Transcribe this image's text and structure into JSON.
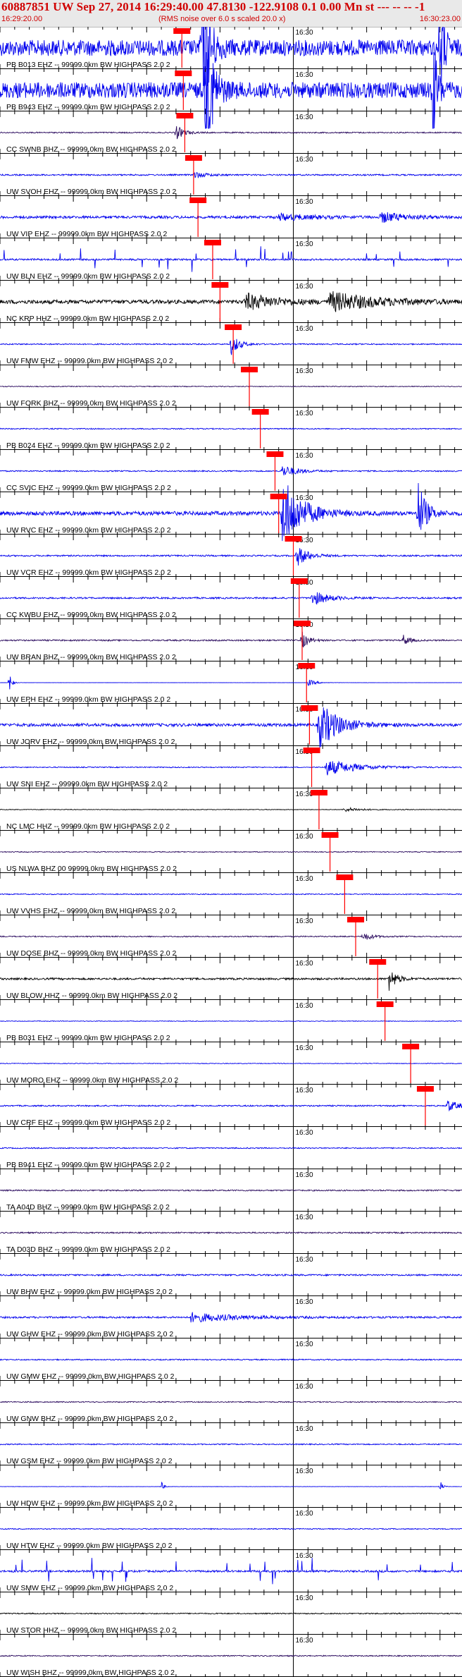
{
  "header": {
    "title": "60887851 UW Sep 27, 2014 16:29:40.00   47.8130 -122.9108  0.1 0.00 Mn st --- -- --   -1",
    "start_time": "16:29:20.00",
    "scale_note": "(RMS noise over 6.0 s scaled 20.0 x)",
    "end_time": "16:30:23.00"
  },
  "colors": {
    "header_text": "#d00000",
    "pick_box": "#ff0000",
    "trace_blue": "#0000ee",
    "trace_black": "#000000",
    "trace_purple": "#2a0a5e"
  },
  "chart_data": {
    "type": "line",
    "x_start": "16:29:20.00",
    "x_end": "16:30:23.00",
    "minute_label": "16:30",
    "tick_interval_s": 2,
    "channels": [
      {
        "label": "PB B013 EHZ -- 99999.0km BW  HIGHPASS  2.0  2",
        "color": "#0000ee",
        "amp": 3.0,
        "bursts": [
          [
            27.5,
            2.0,
            0.9
          ],
          [
            60.0,
            1.5,
            0.5
          ]
        ],
        "pick_s": 24.8,
        "noise": 1.0
      },
      {
        "label": "PB B943 EHZ -- 99999.0km BW  HIGHPASS  2.0  2",
        "color": "#0000ee",
        "amp": 3.0,
        "bursts": [
          [
            28.0,
            2.0,
            0.9
          ],
          [
            59.0,
            1.5,
            0.5
          ]
        ],
        "pick_s": 25.0,
        "noise": 1.0
      },
      {
        "label": "CC SWNB BHZ -- 99999.0km BW  HIGHPASS  2.0  2",
        "color": "#2a0a5e",
        "amp": 0.5,
        "bursts": [
          [
            24.0,
            1.0,
            1.0
          ]
        ],
        "pick_s": 25.2,
        "noise": 0.45
      },
      {
        "label": "UW SVOH EHZ -- 99999.0km BW  HIGHPASS  2.0  2",
        "color": "#0000ee",
        "amp": 0.45,
        "bursts": [
          [
            26.5,
            0.5,
            1.5
          ]
        ],
        "pick_s": 26.4,
        "noise": 0.6
      },
      {
        "label": "UW VIP EHZ -- 99999.0km BW  HIGHPASS  2.0  2",
        "color": "#0000ee",
        "amp": 0.6,
        "bursts": [
          [
            38.0,
            0.4,
            4.0
          ],
          [
            52.0,
            0.6,
            3.0
          ]
        ],
        "pick_s": 27.0,
        "noise": 0.8
      },
      {
        "label": "UW BLN EHZ -- 99999.0km BW  HIGHPASS  2.0  2",
        "color": "#0000ee",
        "amp": 0.9,
        "bursts": [],
        "pick_s": 29.0,
        "noise": 0.35,
        "spiky": true
      },
      {
        "label": "NC KRP HHZ -- 99999.0km BW  HIGHPASS  2.0  2",
        "color": "#000000",
        "amp": 0.9,
        "bursts": [
          [
            33.5,
            0.6,
            4.0
          ],
          [
            45.0,
            0.7,
            6.0
          ]
        ],
        "pick_s": 30.0,
        "noise": 0.8
      },
      {
        "label": "UW FMW EHZ -- 99999.0km BW  HIGHPASS  2.0  2",
        "color": "#0000ee",
        "amp": 0.5,
        "bursts": [
          [
            31.5,
            1.5,
            1.0
          ]
        ],
        "pick_s": 31.8,
        "noise": 0.45
      },
      {
        "label": "UW FORK BHZ -- 99999.0km BW  HIGHPASS  2.0  2",
        "color": "#2a0a5e",
        "amp": 0.3,
        "bursts": [],
        "pick_s": 34.0,
        "noise": 0.5
      },
      {
        "label": "PB B024 EHZ -- 99999.0km BW  HIGHPASS  2.0  2",
        "color": "#0000ee",
        "amp": 0.35,
        "bursts": [],
        "pick_s": 35.5,
        "noise": 0.55
      },
      {
        "label": "CC SVIC EHZ -- 99999.0km BW  HIGHPASS  2.0  2",
        "color": "#0000ee",
        "amp": 0.45,
        "bursts": [
          [
            38.5,
            0.9,
            2.0
          ]
        ],
        "pick_s": 37.5,
        "noise": 0.5
      },
      {
        "label": "UW RVC EHZ -- 99999.0km BW  HIGHPASS  2.0  2",
        "color": "#0000ee",
        "amp": 2.5,
        "bursts": [
          [
            38.5,
            1.0,
            2.5
          ],
          [
            57.0,
            0.9,
            1.0
          ]
        ],
        "pick_s": 38.0,
        "noise": 0.3
      },
      {
        "label": "UW VCR EHZ -- 99999.0km BW  HIGHPASS  2.0  2",
        "color": "#0000ee",
        "amp": 0.7,
        "bursts": [
          [
            40.5,
            1.0,
            1.5
          ]
        ],
        "pick_s": 40.0,
        "noise": 0.4
      },
      {
        "label": "CC KWBU EHZ -- 99999.0km BW  HIGHPASS  2.0  2",
        "color": "#0000ee",
        "amp": 0.6,
        "bursts": [
          [
            42.5,
            0.9,
            2.0
          ]
        ],
        "pick_s": 40.8,
        "noise": 0.5
      },
      {
        "label": "UW BRAN BHZ -- 99999.0km BW  HIGHPASS  2.0  2",
        "color": "#2a0a5e",
        "amp": 0.6,
        "bursts": [
          [
            41.2,
            1.0,
            0.8
          ],
          [
            55.0,
            0.6,
            0.8
          ]
        ],
        "pick_s": 41.2,
        "noise": 0.45
      },
      {
        "label": "UW EPH EHZ -- 99999.0km BW  HIGHPASS  2.0  2",
        "color": "#0000ee",
        "amp": 0.8,
        "bursts": [
          [
            1.3,
            0.9,
            0.3
          ],
          [
            42.0,
            0.3,
            1.0
          ]
        ],
        "pick_s": 41.8,
        "noise": 0.05
      },
      {
        "label": "UW JORV EHZ -- 99999.0km BW  HIGHPASS  2.0  2",
        "color": "#0000ee",
        "amp": 1.6,
        "bursts": [
          [
            43.5,
            1.0,
            2.5
          ]
        ],
        "pick_s": 42.2,
        "noise": 0.35
      },
      {
        "label": "UW SNI EHZ -- 99999.0km BW  HIGHPASS  2.0  2",
        "color": "#0000ee",
        "amp": 0.6,
        "bursts": [
          [
            44.5,
            0.9,
            4.0
          ]
        ],
        "pick_s": 42.5,
        "noise": 0.3
      },
      {
        "label": "NC LMC HHZ -- 99999.0km BW  HIGHPASS  2.0  2",
        "color": "#000000",
        "amp": 0.25,
        "bursts": [
          [
            47.0,
            0.6,
            2.0
          ]
        ],
        "pick_s": 43.5,
        "noise": 0.5
      },
      {
        "label": "US NLWA BHZ 00 99999.0km BW  HIGHPASS  2.0  2",
        "color": "#2a0a5e",
        "amp": 0.3,
        "bursts": [],
        "pick_s": 45.0,
        "noise": 0.55
      },
      {
        "label": "UW VVHS EHZ -- 99999.0km BW  HIGHPASS  2.0  2",
        "color": "#0000ee",
        "amp": 0.3,
        "bursts": [],
        "pick_s": 47.0,
        "noise": 0.6
      },
      {
        "label": "UW DOSE BHZ -- 99999.0km BW  HIGHPASS  2.0  2",
        "color": "#2a0a5e",
        "amp": 0.35,
        "bursts": [
          [
            49.5,
            0.8,
            1.2
          ]
        ],
        "pick_s": 48.5,
        "noise": 0.6
      },
      {
        "label": "UW BLOW HHZ -- 99999.0km BW  HIGHPASS  2.0  2",
        "color": "#000000",
        "amp": 0.8,
        "bursts": [
          [
            53.0,
            1.0,
            1.0
          ]
        ],
        "pick_s": 51.5,
        "noise": 0.45
      },
      {
        "label": "PB B031 EHZ -- 99999.0km BW  HIGHPASS  2.0  2",
        "color": "#0000ee",
        "amp": 0.25,
        "bursts": [],
        "pick_s": 52.5,
        "noise": 0.5
      },
      {
        "label": "UW MORO EHZ -- 99999.0km BW  HIGHPASS  2.0  2",
        "color": "#0000ee",
        "amp": 0.25,
        "bursts": [],
        "pick_s": 56.0,
        "noise": 0.5
      },
      {
        "label": "UW CRF EHZ -- 99999.0km BW  HIGHPASS  2.0  2",
        "color": "#0000ee",
        "amp": 0.45,
        "bursts": [
          [
            61.0,
            0.9,
            1.5
          ]
        ],
        "pick_s": 58.0,
        "noise": 0.55
      },
      {
        "label": "PB B941 EHZ -- 99999.0km BW  HIGHPASS  2.0  2",
        "color": "#0000ee",
        "amp": 0.3,
        "bursts": [],
        "pick_s": null,
        "noise": 0.7
      },
      {
        "label": "TA A04D BHZ -- 99999.0km BW  HIGHPASS  2.0  2",
        "color": "#2a0a5e",
        "amp": 0.35,
        "bursts": [],
        "pick_s": null,
        "noise": 0.7
      },
      {
        "label": "TA D03D BHZ -- 99999.0km BW  HIGHPASS  2.0  2",
        "color": "#2a0a5e",
        "amp": 0.35,
        "bursts": [],
        "pick_s": null,
        "noise": 0.7
      },
      {
        "label": "UW BHW EHZ -- 99999.0km BW  HIGHPASS  2.0  2",
        "color": "#0000ee",
        "amp": 0.4,
        "bursts": [],
        "pick_s": null,
        "noise": 0.75
      },
      {
        "label": "UW GHW EHZ -- 99999.0km BW  HIGHPASS  2.0  2",
        "color": "#0000ee",
        "amp": 0.45,
        "bursts": [
          [
            26.0,
            0.7,
            6.0
          ]
        ],
        "pick_s": null,
        "noise": 0.75
      },
      {
        "label": "UW GMW EHZ -- 99999.0km BW  HIGHPASS  2.0  2",
        "color": "#0000ee",
        "amp": 0.3,
        "bursts": [],
        "pick_s": null,
        "noise": 0.7
      },
      {
        "label": "UW GNW BHZ -- 99999.0km BW  HIGHPASS  2.0  2",
        "color": "#2a0a5e",
        "amp": 0.3,
        "bursts": [],
        "pick_s": null,
        "noise": 0.65
      },
      {
        "label": "UW GSM EHZ -- 99999.0km BW  HIGHPASS  2.0  2",
        "color": "#0000ee",
        "amp": 0.3,
        "bursts": [],
        "pick_s": null,
        "noise": 0.7
      },
      {
        "label": "UW HDW EHZ -- 99999.0km BW  HIGHPASS  2.0  2",
        "color": "#0000ee",
        "amp": 0.6,
        "bursts": [
          [
            22.0,
            0.6,
            0.3
          ],
          [
            60.0,
            0.8,
            0.3
          ]
        ],
        "pick_s": null,
        "noise": 0.1
      },
      {
        "label": "UW HTW EHZ -- 99999.0km BW  HIGHPASS  2.0  2",
        "color": "#0000ee",
        "amp": 0.3,
        "bursts": [],
        "pick_s": null,
        "noise": 0.6
      },
      {
        "label": "UW SMW EHZ -- 99999.0km BW  HIGHPASS  2.0  2",
        "color": "#0000ee",
        "amp": 0.9,
        "bursts": [],
        "pick_s": null,
        "noise": 0.4,
        "spiky": true
      },
      {
        "label": "UW STOR HHZ -- 99999.0km BW  HIGHPASS  2.0  2",
        "color": "#000000",
        "amp": 0.3,
        "bursts": [],
        "pick_s": null,
        "noise": 0.7
      },
      {
        "label": "UW WISH BHZ -- 99999.0km BW  HIGHPASS  2.0  2",
        "color": "#2a0a5e",
        "amp": 0.3,
        "bursts": [],
        "pick_s": null,
        "noise": 0.7
      }
    ]
  }
}
